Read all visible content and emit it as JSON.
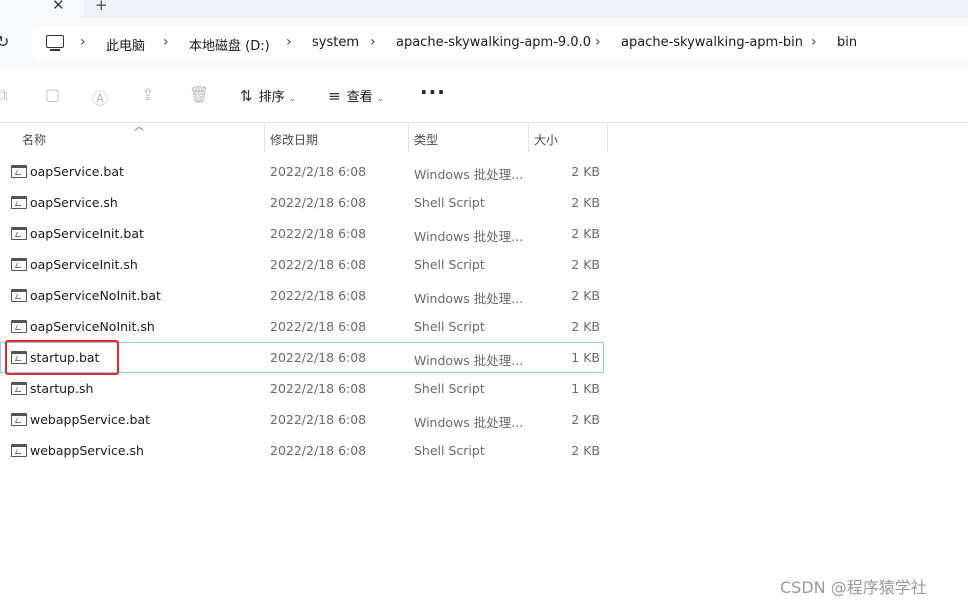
{
  "tabs": {
    "close_glyph": "✕",
    "new_glyph": "+"
  },
  "address": {
    "refresh_glyph": "↻",
    "separator": "›",
    "crumbs": [
      "此电脑",
      "本地磁盘 (D:)",
      "system",
      "apache-skywalking-apm-9.0.0",
      "apache-skywalking-apm-bin",
      "bin"
    ]
  },
  "toolbar": {
    "sort_label": "排序",
    "view_label": "查看",
    "more_glyph": "···",
    "icons": [
      "copy-icon",
      "paste-icon",
      "rename-icon",
      "share-icon",
      "delete-icon"
    ]
  },
  "columns": {
    "name": "名称",
    "date": "修改日期",
    "type": "类型",
    "size": "大小"
  },
  "files": [
    {
      "name": "oapService.bat",
      "date": "2022/2/18 6:08",
      "type": "Windows 批处理...",
      "size": "2 KB"
    },
    {
      "name": "oapService.sh",
      "date": "2022/2/18 6:08",
      "type": "Shell Script",
      "size": "2 KB"
    },
    {
      "name": "oapServiceInit.bat",
      "date": "2022/2/18 6:08",
      "type": "Windows 批处理...",
      "size": "2 KB"
    },
    {
      "name": "oapServiceInit.sh",
      "date": "2022/2/18 6:08",
      "type": "Shell Script",
      "size": "2 KB"
    },
    {
      "name": "oapServiceNoInit.bat",
      "date": "2022/2/18 6:08",
      "type": "Windows 批处理...",
      "size": "2 KB"
    },
    {
      "name": "oapServiceNoInit.sh",
      "date": "2022/2/18 6:08",
      "type": "Shell Script",
      "size": "2 KB"
    },
    {
      "name": "startup.bat",
      "date": "2022/2/18 6:08",
      "type": "Windows 批处理...",
      "size": "1 KB"
    },
    {
      "name": "startup.sh",
      "date": "2022/2/18 6:08",
      "type": "Shell Script",
      "size": "1 KB"
    },
    {
      "name": "webappService.bat",
      "date": "2022/2/18 6:08",
      "type": "Windows 批处理...",
      "size": "2 KB"
    },
    {
      "name": "webappService.sh",
      "date": "2022/2/18 6:08",
      "type": "Shell Script",
      "size": "2 KB"
    }
  ],
  "watermark": "CSDN @程序猿学社",
  "colors": {
    "highlight": "#e12a2a",
    "selection": "#99c9ef"
  }
}
